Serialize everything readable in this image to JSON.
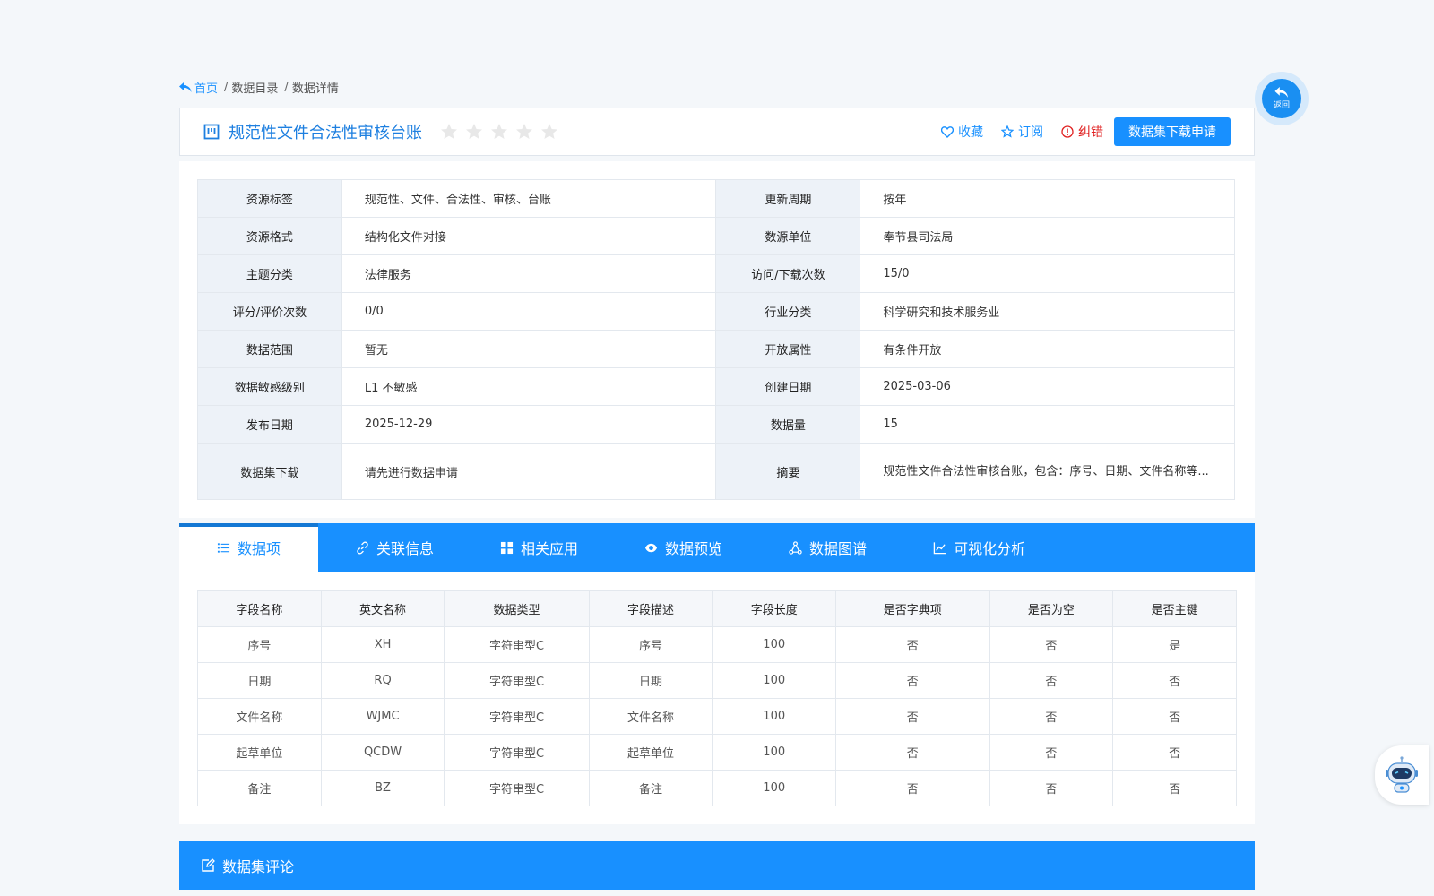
{
  "breadcrumb": {
    "home": "首页",
    "items": [
      "数据目录",
      "数据详情"
    ]
  },
  "dataset": {
    "title": "规范性文件合法性审核台账",
    "rating_stars": 5,
    "rating_value": 0
  },
  "actions": {
    "favorite": "收藏",
    "subscribe": "订阅",
    "report": "纠错",
    "apply": "数据集下载申请"
  },
  "info": [
    [
      "资源标签",
      "规范性、文件、合法性、审核、台账",
      "更新周期",
      "按年"
    ],
    [
      "资源格式",
      "结构化文件对接",
      "数源单位",
      "奉节县司法局"
    ],
    [
      "主题分类",
      "法律服务",
      "访问/下载次数",
      "15/0"
    ],
    [
      "评分/评价次数",
      "0/0",
      "行业分类",
      "科学研究和技术服务业"
    ],
    [
      "数据范围",
      "暂无",
      "开放属性",
      "有条件开放"
    ],
    [
      "数据敏感级别",
      "L1 不敏感",
      "创建日期",
      "2025-03-06"
    ],
    [
      "发布日期",
      "2025-12-29",
      "数据量",
      "15"
    ],
    [
      "数据集下载",
      "请先进行数据申请",
      "摘要",
      "规范性文件合法性审核台账，包含：序号、日期、文件名称等..."
    ]
  ],
  "tabs": [
    "数据项",
    "关联信息",
    "相关应用",
    "数据预览",
    "数据图谱",
    "可视化分析"
  ],
  "fields_table": {
    "headers": [
      "字段名称",
      "英文名称",
      "数据类型",
      "字段描述",
      "字段长度",
      "是否字典项",
      "是否为空",
      "是否主键"
    ],
    "rows": [
      [
        "序号",
        "XH",
        "字符串型C",
        "序号",
        "100",
        "否",
        "否",
        "是"
      ],
      [
        "日期",
        "RQ",
        "字符串型C",
        "日期",
        "100",
        "否",
        "否",
        "否"
      ],
      [
        "文件名称",
        "WJMC",
        "字符串型C",
        "文件名称",
        "100",
        "否",
        "否",
        "否"
      ],
      [
        "起草单位",
        "QCDW",
        "字符串型C",
        "起草单位",
        "100",
        "否",
        "否",
        "否"
      ],
      [
        "备注",
        "BZ",
        "字符串型C",
        "备注",
        "100",
        "否",
        "否",
        "否"
      ]
    ]
  },
  "comment": {
    "title": "数据集评论"
  },
  "back": {
    "label": "返回"
  },
  "colors": {
    "primary": "#1890ff",
    "title": "#1d7fe0",
    "danger": "#e02020",
    "label_bg": "#edf2f8"
  },
  "icons": [
    "reply-icon",
    "dataset-icon",
    "star-icon",
    "heart-icon",
    "alert-icon",
    "list-icon",
    "link-icon",
    "grid-icon",
    "eye-icon",
    "graph-icon",
    "line-chart-icon",
    "edit-icon",
    "robot-icon"
  ]
}
